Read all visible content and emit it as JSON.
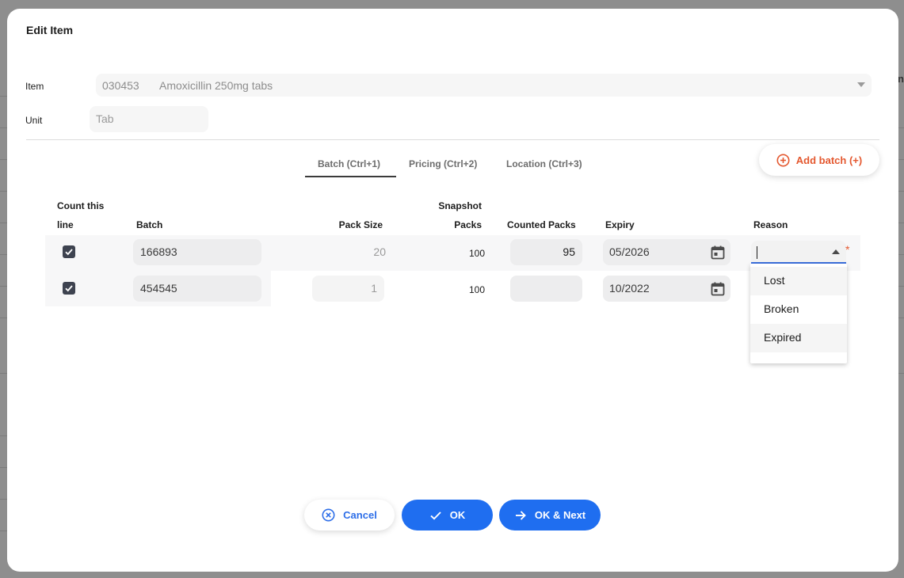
{
  "modal": {
    "title": "Edit Item"
  },
  "form": {
    "item_label": "Item",
    "item_code": "030453",
    "item_name": "Amoxicillin 250mg tabs",
    "unit_label": "Unit",
    "unit_placeholder": "Tab"
  },
  "tabs": [
    {
      "label": "Batch (Ctrl+1)",
      "active": true
    },
    {
      "label": "Pricing (Ctrl+2)",
      "active": false
    },
    {
      "label": "Location (Ctrl+3)",
      "active": false
    }
  ],
  "add_batch_label": "Add batch (+)",
  "table": {
    "headers": {
      "count_line_1": "Count this",
      "count_line_2": "line",
      "batch": "Batch",
      "pack_size": "Pack Size",
      "snapshot_line_1": "Snapshot",
      "snapshot_line_2": "Packs",
      "counted_packs": "Counted Packs",
      "expiry": "Expiry",
      "reason": "Reason"
    },
    "rows": [
      {
        "checked": true,
        "batch": "166893",
        "pack_size": "20",
        "snapshot_packs": "100",
        "counted_packs": "95",
        "expiry": "05/2026"
      },
      {
        "checked": true,
        "batch": "454545",
        "pack_size": "1",
        "snapshot_packs": "100",
        "counted_packs": "",
        "expiry": "10/2022"
      }
    ]
  },
  "reason": {
    "required_mark": "*",
    "options": [
      "Lost",
      "Broken",
      "Expired"
    ]
  },
  "buttons": {
    "cancel": "Cancel",
    "ok": "OK",
    "ok_next": "OK & Next"
  },
  "background_page": {
    "right_header_fragment": "n"
  },
  "colors": {
    "primary": "#1f6ef0",
    "accent": "#e4582f",
    "checkbox": "#3e4350",
    "field_bg": "#ededee"
  }
}
